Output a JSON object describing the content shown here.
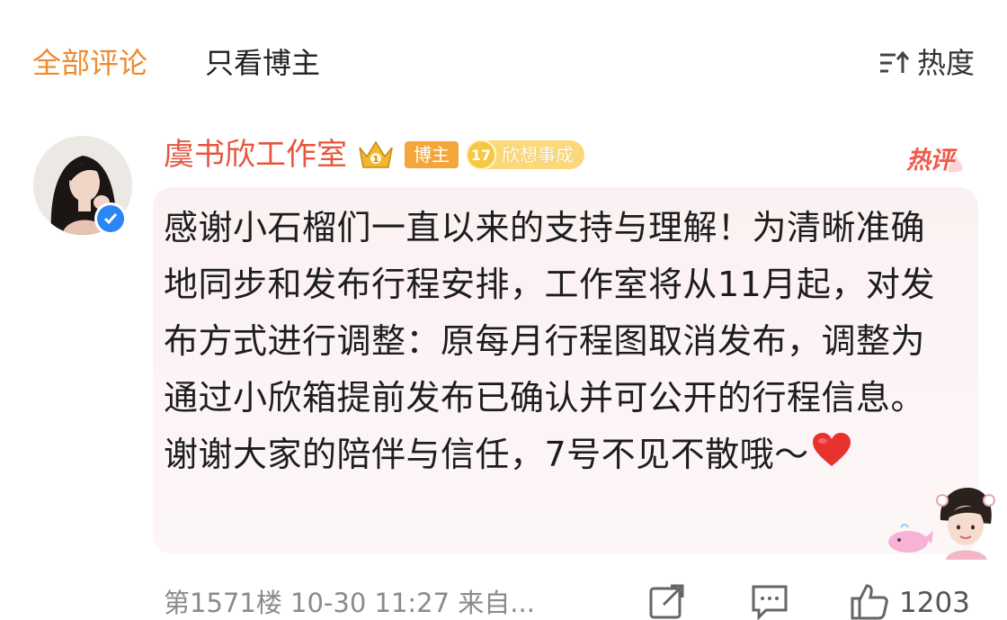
{
  "tabs": {
    "all_comments": "全部评论",
    "blogger_only": "只看博主"
  },
  "sort": {
    "label": "热度",
    "icon": "sort-icon"
  },
  "comment": {
    "username": "虞书欣工作室",
    "badges": {
      "crown_level": "1",
      "blogger": "博主",
      "fan_level": "17",
      "fan_group": "欣想事成"
    },
    "hot_label": "热评",
    "text": "感谢小石榴们一直以来的支持与理解！为清晰准确地同步和发布行程安排，工作室将从11月起，对发布方式进行调整：原每月行程图取消发布，调整为通过小欣箱提前发布已确认并可公开的行程信息。 谢谢大家的陪伴与信任，7号不见不散哦～",
    "meta": "第1571楼  10-30 11:27  来自...",
    "likes": "1203"
  },
  "colors": {
    "accent_orange": "#ef8a2e",
    "username_red": "#e8553f",
    "bubble_pink": "#fbf1f2",
    "meta_gray": "#8a8a8a",
    "verified_blue": "#2a86f2"
  }
}
